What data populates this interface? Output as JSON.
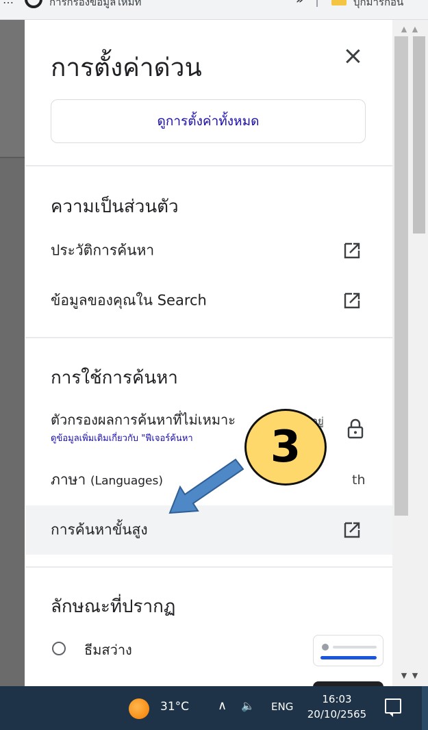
{
  "browser": {
    "menu_dots": "…",
    "tab_text": "การกรองข้อมูลใหม่ที่",
    "overflow_chevron": "»",
    "bookmark_label": "บุ๊กมาร์กอื่น"
  },
  "panel": {
    "title": "การตั้งค่าด่วน",
    "all_settings_label": "ดูการตั้งค่าทั้งหมด"
  },
  "privacy": {
    "title": "ความเป็นส่วนตัว",
    "search_history": "ประวัติการค้นหา",
    "your_data": "ข้อมูลของคุณใน Search"
  },
  "search_usage": {
    "title": "การใช้การค้นหา",
    "filter_label": "ตัวกรองผลการค้นหาที่ไม่เหมาะ",
    "filter_trailing": "อยู่",
    "filter_link": "ดูข้อมูลเพิ่มเติมเกี่ยวกับ \"ฟีเจอร์ค้นหา",
    "language_label": "ภาษา",
    "language_sub": "(Languages)",
    "language_value": "th",
    "advanced_search": "การค้นหาขั้นสูง"
  },
  "appearance": {
    "title": "ลักษณะที่ปรากฏ",
    "light_theme": "ธีมสว่าง"
  },
  "annotation": {
    "step_number": "3",
    "color": "#ffd86b",
    "arrow_color": "#4f88c6"
  },
  "taskbar": {
    "temperature": "31°C",
    "tray_up": "∧",
    "speaker": "🔈",
    "language": "ENG",
    "time": "16:03",
    "date": "20/10/2565"
  },
  "scrollbar": {
    "up_arrows": "▲ ▲",
    "down_arrows": "▼ ▼"
  },
  "colors": {
    "link_blue": "#1a0dab",
    "taskbar_bg": "#1e3347",
    "highlight_row": "#f1f3f4"
  }
}
